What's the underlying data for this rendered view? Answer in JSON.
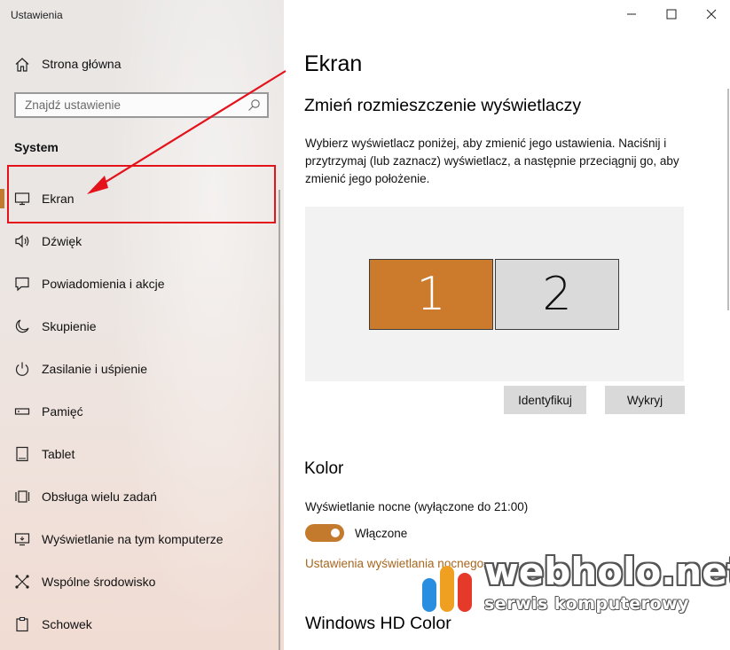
{
  "window": {
    "title": "Ustawienia"
  },
  "sidebar": {
    "home_label": "Strona główna",
    "search_placeholder": "Znajdź ustawienie",
    "section": "System",
    "items": [
      {
        "label": "Ekran",
        "icon": "monitor-icon",
        "active": true
      },
      {
        "label": "Dźwięk",
        "icon": "speaker-icon"
      },
      {
        "label": "Powiadomienia i akcje",
        "icon": "notification-icon"
      },
      {
        "label": "Skupienie",
        "icon": "moon-icon"
      },
      {
        "label": "Zasilanie i uśpienie",
        "icon": "power-icon"
      },
      {
        "label": "Pamięć",
        "icon": "storage-icon"
      },
      {
        "label": "Tablet",
        "icon": "tablet-icon"
      },
      {
        "label": "Obsługa wielu zadań",
        "icon": "multitasking-icon"
      },
      {
        "label": "Wyświetlanie na tym komputerze",
        "icon": "project-icon"
      },
      {
        "label": "Wspólne środowisko",
        "icon": "shared-experiences-icon"
      },
      {
        "label": "Schowek",
        "icon": "clipboard-icon"
      }
    ]
  },
  "main": {
    "title": "Ekran",
    "arrange_heading": "Zmień rozmieszczenie wyświetlaczy",
    "arrange_description": "Wybierz wyświetlacz poniżej, aby zmienić jego ustawienia. Naciśnij i przytrzymaj (lub zaznacz) wyświetlacz, a następnie przeciągnij go, aby zmienić jego położenie.",
    "displays": [
      "1",
      "2"
    ],
    "identify_button": "Identyfikuj",
    "detect_button": "Wykryj",
    "color_heading": "Kolor",
    "night_light_label": "Wyświetlanie nocne (wyłączone do 21:00)",
    "night_light_state": "Włączone",
    "night_light_link": "Ustawienia wyświetlania nocnego",
    "hdr_heading": "Windows HD Color"
  },
  "watermark": {
    "brand": "webholo.net",
    "tagline": "serwis komputerowy"
  },
  "colors": {
    "accent": "#c47a2c",
    "display1": "#cc7a2c",
    "display2": "#dadada",
    "annotation": "#e4121b"
  }
}
